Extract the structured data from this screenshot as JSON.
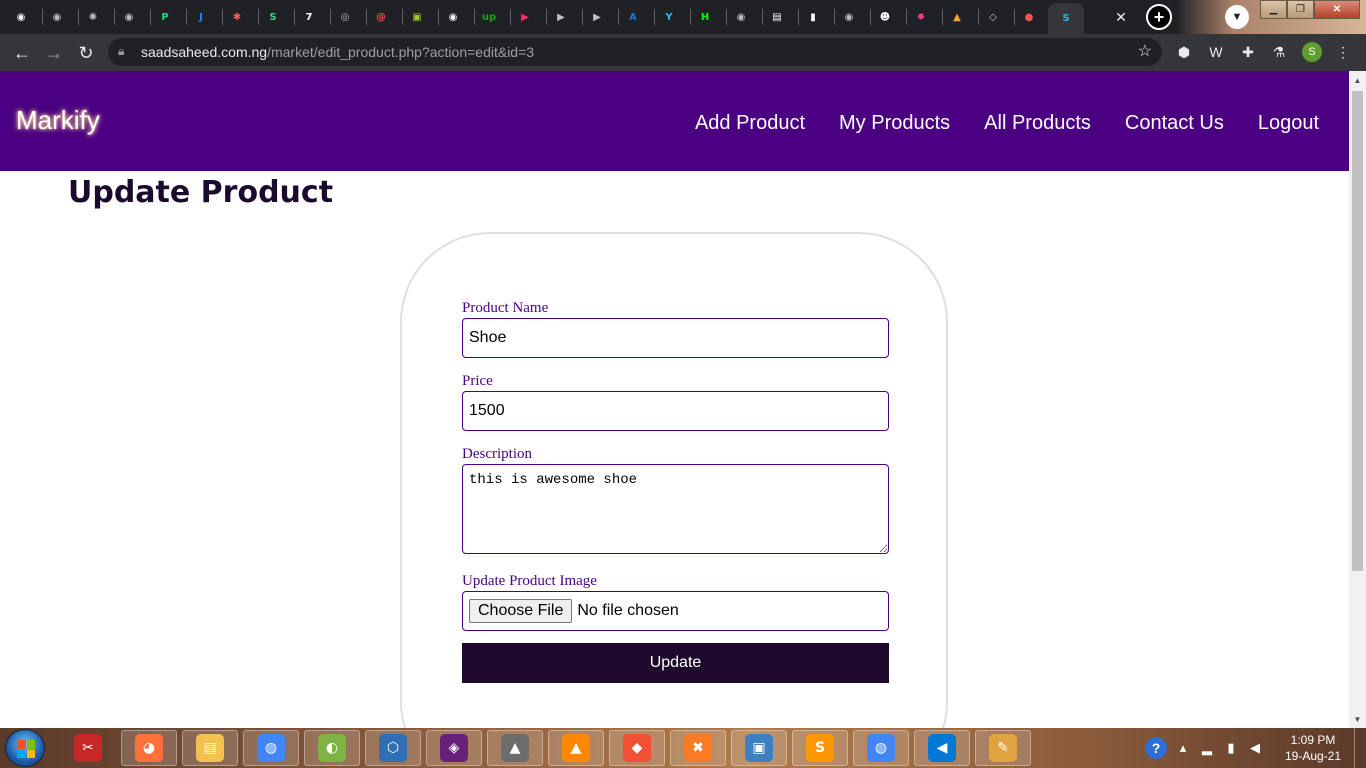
{
  "browser": {
    "tab_close_glyph": "✕",
    "new_tab_glyph": "+",
    "url_host": "saadsaheed.com.ng",
    "url_path": "/market/edit_product.php?action=edit&id=3",
    "profile_initial": "S",
    "tab_favicons": [
      {
        "icon": "globe-icon",
        "color": "#ffffff",
        "glyph": "◉"
      },
      {
        "icon": "globe-icon",
        "color": "#bdc1c6",
        "glyph": "◉"
      },
      {
        "icon": "openai-icon",
        "color": "#bdc1c6",
        "glyph": "✺"
      },
      {
        "icon": "globe-icon",
        "color": "#bdc1c6",
        "glyph": "◉"
      },
      {
        "icon": "pycharm-icon",
        "color": "#21d789",
        "glyph": "P"
      },
      {
        "icon": "jira-icon",
        "color": "#2684ff",
        "glyph": "J"
      },
      {
        "icon": "asterisk-icon",
        "color": "#ff5a5f",
        "glyph": "✱"
      },
      {
        "icon": "s-icon",
        "color": "#3ecf8e",
        "glyph": "S"
      },
      {
        "icon": "seven-icon",
        "color": "#ffffff",
        "glyph": "7"
      },
      {
        "icon": "github-icon",
        "color": "#bdc1c6",
        "glyph": "◎"
      },
      {
        "icon": "at-icon",
        "color": "#ff4b4b",
        "glyph": "@"
      },
      {
        "icon": "android-icon",
        "color": "#a4c639",
        "glyph": "▣"
      },
      {
        "icon": "globe-icon",
        "color": "#ffffff",
        "glyph": "◉"
      },
      {
        "icon": "upwork-icon",
        "color": "#14a800",
        "glyph": "up"
      },
      {
        "icon": "play-icon",
        "color": "#ff2a6d",
        "glyph": "▶"
      },
      {
        "icon": "play-icon",
        "color": "#bdc1c6",
        "glyph": "▶"
      },
      {
        "icon": "play-icon",
        "color": "#bdc1c6",
        "glyph": "▶"
      },
      {
        "icon": "angular-icon",
        "color": "#1976d2",
        "glyph": "A"
      },
      {
        "icon": "yammer-icon",
        "color": "#29b6f6",
        "glyph": "Y"
      },
      {
        "icon": "hackernoon-icon",
        "color": "#00ff00",
        "glyph": "H"
      },
      {
        "icon": "globe-icon",
        "color": "#bdc1c6",
        "glyph": "◉"
      },
      {
        "icon": "briefcase-icon",
        "color": "#ffffff",
        "glyph": "▤"
      },
      {
        "icon": "bar-chart-icon",
        "color": "#ffffff",
        "glyph": "▮"
      },
      {
        "icon": "globe-icon",
        "color": "#bdc1c6",
        "glyph": "◉"
      },
      {
        "icon": "avatar-icon",
        "color": "#ffffff",
        "glyph": "☻"
      },
      {
        "icon": "firework-icon",
        "color": "#ff3d8b",
        "glyph": "✸"
      },
      {
        "icon": "pwa-icon",
        "color": "#f7a928",
        "glyph": "▲"
      },
      {
        "icon": "laravel-icon",
        "color": "#bdc1c6",
        "glyph": "◇"
      },
      {
        "icon": "red-circle-icon",
        "color": "#ff5252",
        "glyph": "●"
      },
      {
        "icon": "s-icon",
        "color": "#29b6f6",
        "glyph": "S"
      }
    ]
  },
  "site": {
    "brand": "Markify",
    "nav": [
      "Add Product",
      "My Products",
      "All Products",
      "Contact Us",
      "Logout"
    ],
    "page_title": "Update Product"
  },
  "form": {
    "product_name_label": "Product Name",
    "product_name_value": "Shoe",
    "price_label": "Price",
    "price_value": "1500",
    "description_label": "Description",
    "description_value": "this is awesome shoe",
    "image_label": "Update Product Image",
    "choose_file_label": "Choose File",
    "file_status": "No file chosen",
    "submit_label": "Update"
  },
  "taskbar": {
    "apps": [
      {
        "icon": "snipping-tool-icon",
        "color": "#c62828",
        "glyph": "✂"
      },
      {
        "icon": "firefox-icon",
        "color": "#ff7139",
        "glyph": "◕"
      },
      {
        "icon": "file-explorer-icon",
        "color": "#f2c14e",
        "glyph": "▤"
      },
      {
        "icon": "chrome-icon",
        "color": "#4285f4",
        "glyph": "◍"
      },
      {
        "icon": "chameleon-icon",
        "color": "#7cb342",
        "glyph": "◐"
      },
      {
        "icon": "virtualbox-icon",
        "color": "#2f6fb5",
        "glyph": "⬡"
      },
      {
        "icon": "visual-studio-icon",
        "color": "#68217a",
        "glyph": "◈"
      },
      {
        "icon": "inkscape-icon",
        "color": "#6d6d6d",
        "glyph": "▲"
      },
      {
        "icon": "vlc-icon",
        "color": "#ff8800",
        "glyph": "▲"
      },
      {
        "icon": "git-icon",
        "color": "#f05033",
        "glyph": "◆"
      },
      {
        "icon": "xampp-icon",
        "color": "#fb7a24",
        "glyph": "✖"
      },
      {
        "icon": "photo-viewer-icon",
        "color": "#3d7fc1",
        "glyph": "▣"
      },
      {
        "icon": "sublime-text-icon",
        "color": "#ff9800",
        "glyph": "S"
      },
      {
        "icon": "chrome-icon",
        "color": "#4285f4",
        "glyph": "◍"
      },
      {
        "icon": "vscode-icon",
        "color": "#0078d4",
        "glyph": "◀"
      },
      {
        "icon": "paint-icon",
        "color": "#e0a340",
        "glyph": "✎"
      }
    ],
    "time": "1:09 PM",
    "date": "19-Aug-21",
    "help_glyph": "?"
  }
}
